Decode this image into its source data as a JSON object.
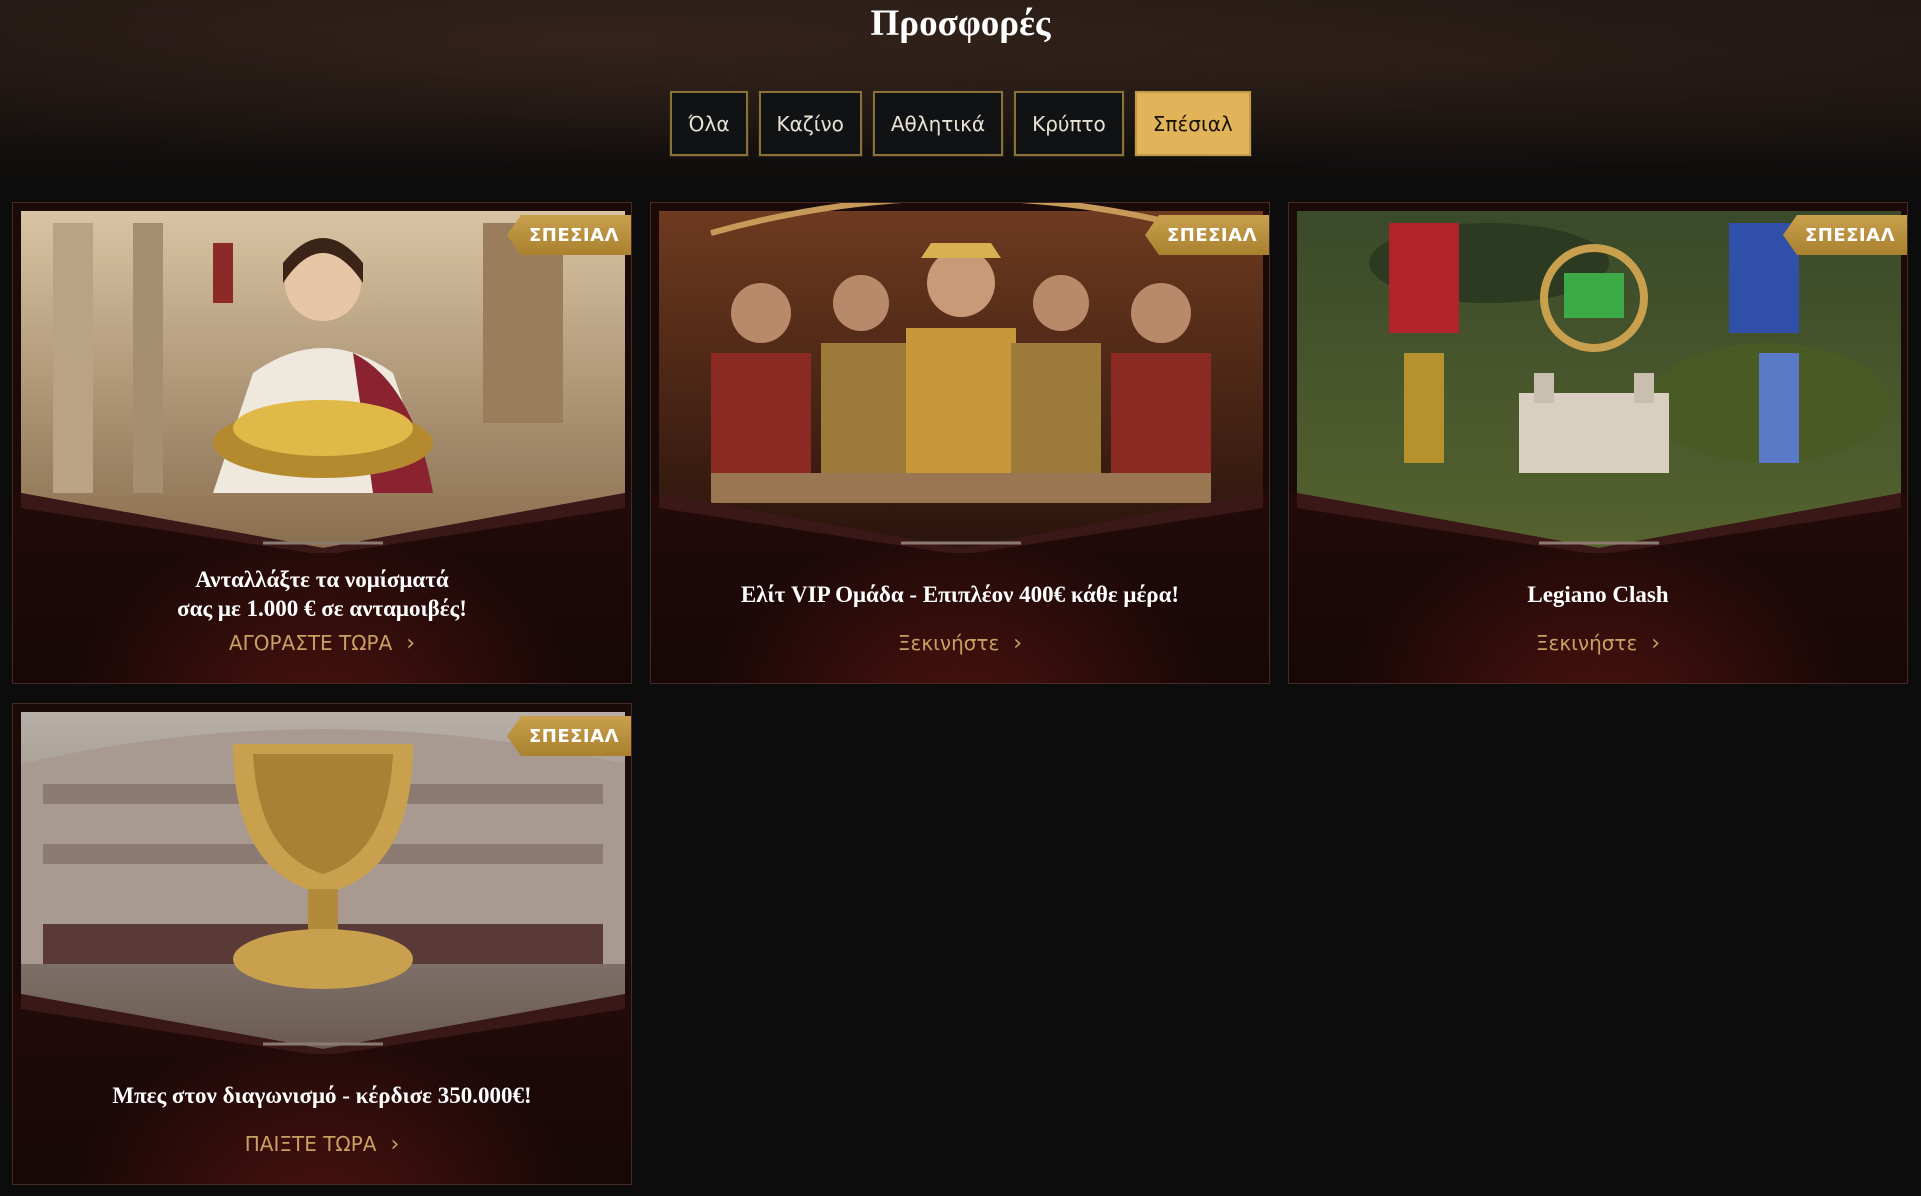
{
  "page": {
    "title": "Προσφορές"
  },
  "filters": [
    {
      "label": "Όλα",
      "active": false
    },
    {
      "label": "Καζίνο",
      "active": false
    },
    {
      "label": "Αθλητικά",
      "active": false
    },
    {
      "label": "Κρύπτο",
      "active": false
    },
    {
      "label": "Σπέσιαλ",
      "active": true
    }
  ],
  "cards": [
    {
      "badge": "ΣΠΕΣΙΑΛ",
      "title_line1": "Ανταλλάξτε τα νομίσματά",
      "title_line2": "σας με 1.000 € σε ανταμοιβές!",
      "cta": "ΑΓΟΡΑΣΤΕ ΤΩΡΑ"
    },
    {
      "badge": "ΣΠΕΣΙΑΛ",
      "title": "Ελίτ VIP Ομάδα - Επιπλέον 400€ κάθε μέρα!",
      "cta": "Ξεκινήστε"
    },
    {
      "badge": "ΣΠΕΣΙΑΛ",
      "title": "Legiano Clash",
      "cta": "Ξεκινήστε"
    },
    {
      "badge": "ΣΠΕΣΙΑΛ",
      "title": "Μπες στον διαγωνισμό - κέρδισε 350.000€!",
      "cta": "ΠΑΙΞΤΕ ΤΩΡΑ"
    }
  ],
  "colors": {
    "accent": "#e2b459",
    "cta": "#c9a061",
    "card_bg": "#1a0a0a"
  }
}
